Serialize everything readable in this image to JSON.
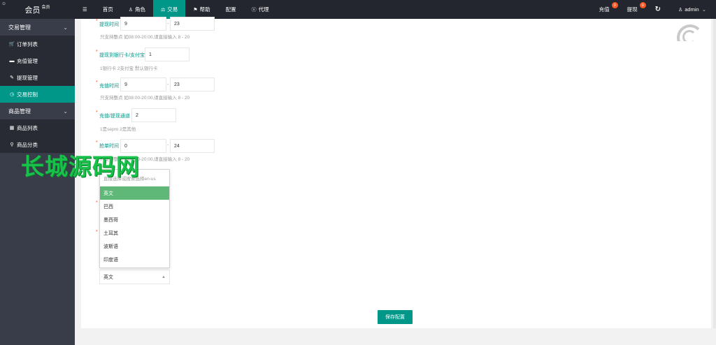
{
  "app": {
    "logo_text": "会员",
    "logo_sup": "会员",
    "logo_mini": "⊙"
  },
  "sidebar": {
    "group1": "交易管理",
    "items1": [
      {
        "label": "订单列表",
        "icon": "🛒"
      },
      {
        "label": "充值管理",
        "icon": "▬"
      },
      {
        "label": "提现管理",
        "icon": "✎"
      },
      {
        "label": "交易控制",
        "icon": "◷"
      }
    ],
    "group2": "商品管理",
    "items2": [
      {
        "label": "商品列表",
        "icon": "▦"
      },
      {
        "label": "商品分类",
        "icon": "⚲"
      }
    ]
  },
  "header": {
    "menu_icon": "☰",
    "nav": [
      {
        "label": "首页",
        "icon": ""
      },
      {
        "label": "角色",
        "icon": "♙"
      },
      {
        "label": "交易",
        "icon": "⚖"
      },
      {
        "label": "帮助",
        "icon": "⚑"
      },
      {
        "label": "配置",
        "icon": ""
      },
      {
        "label": "代理",
        "icon": "ⓢ"
      }
    ],
    "recharge": "充值",
    "recharge_badge": "0",
    "withdraw": "提现",
    "withdraw_badge": "0",
    "refresh_icon": "↻",
    "user": "admin",
    "user_icon": "♙",
    "user_caret": "⌄"
  },
  "form": {
    "withdraw_time": {
      "label": "提现时间",
      "from": "9",
      "to": "23",
      "tip": "只支持整点 如08:00-20:00,请直接输入 8 - 20"
    },
    "withdraw_to": {
      "label": "提现到银行卡/支付宝",
      "value": "1",
      "tip": "1银行卡 2支付宝 默认银行卡"
    },
    "recharge_time": {
      "label": "充值时间",
      "from": "9",
      "to": "23",
      "tip": "只支持整点 如08:00-20:00,请直接输入 8 - 20"
    },
    "channel": {
      "label": "充值/提现通道",
      "value": "2",
      "tip": "1是sepro 2是其他"
    },
    "grab_time": {
      "label": "抢单时间",
      "from": "0",
      "to": "24",
      "tip": "只支持整点 如08:00-20:00,请直接输入 8 - 20"
    },
    "dash": "-"
  },
  "dropdown": {
    "search_placeholder": "直接选择或搜索选择en-us",
    "options": [
      "英文",
      "巴西",
      "墨西哥",
      "土耳其",
      "波斯语",
      "印度语"
    ],
    "selected": "英文"
  },
  "save_label": "保存配置",
  "watermark": "长城源码网"
}
